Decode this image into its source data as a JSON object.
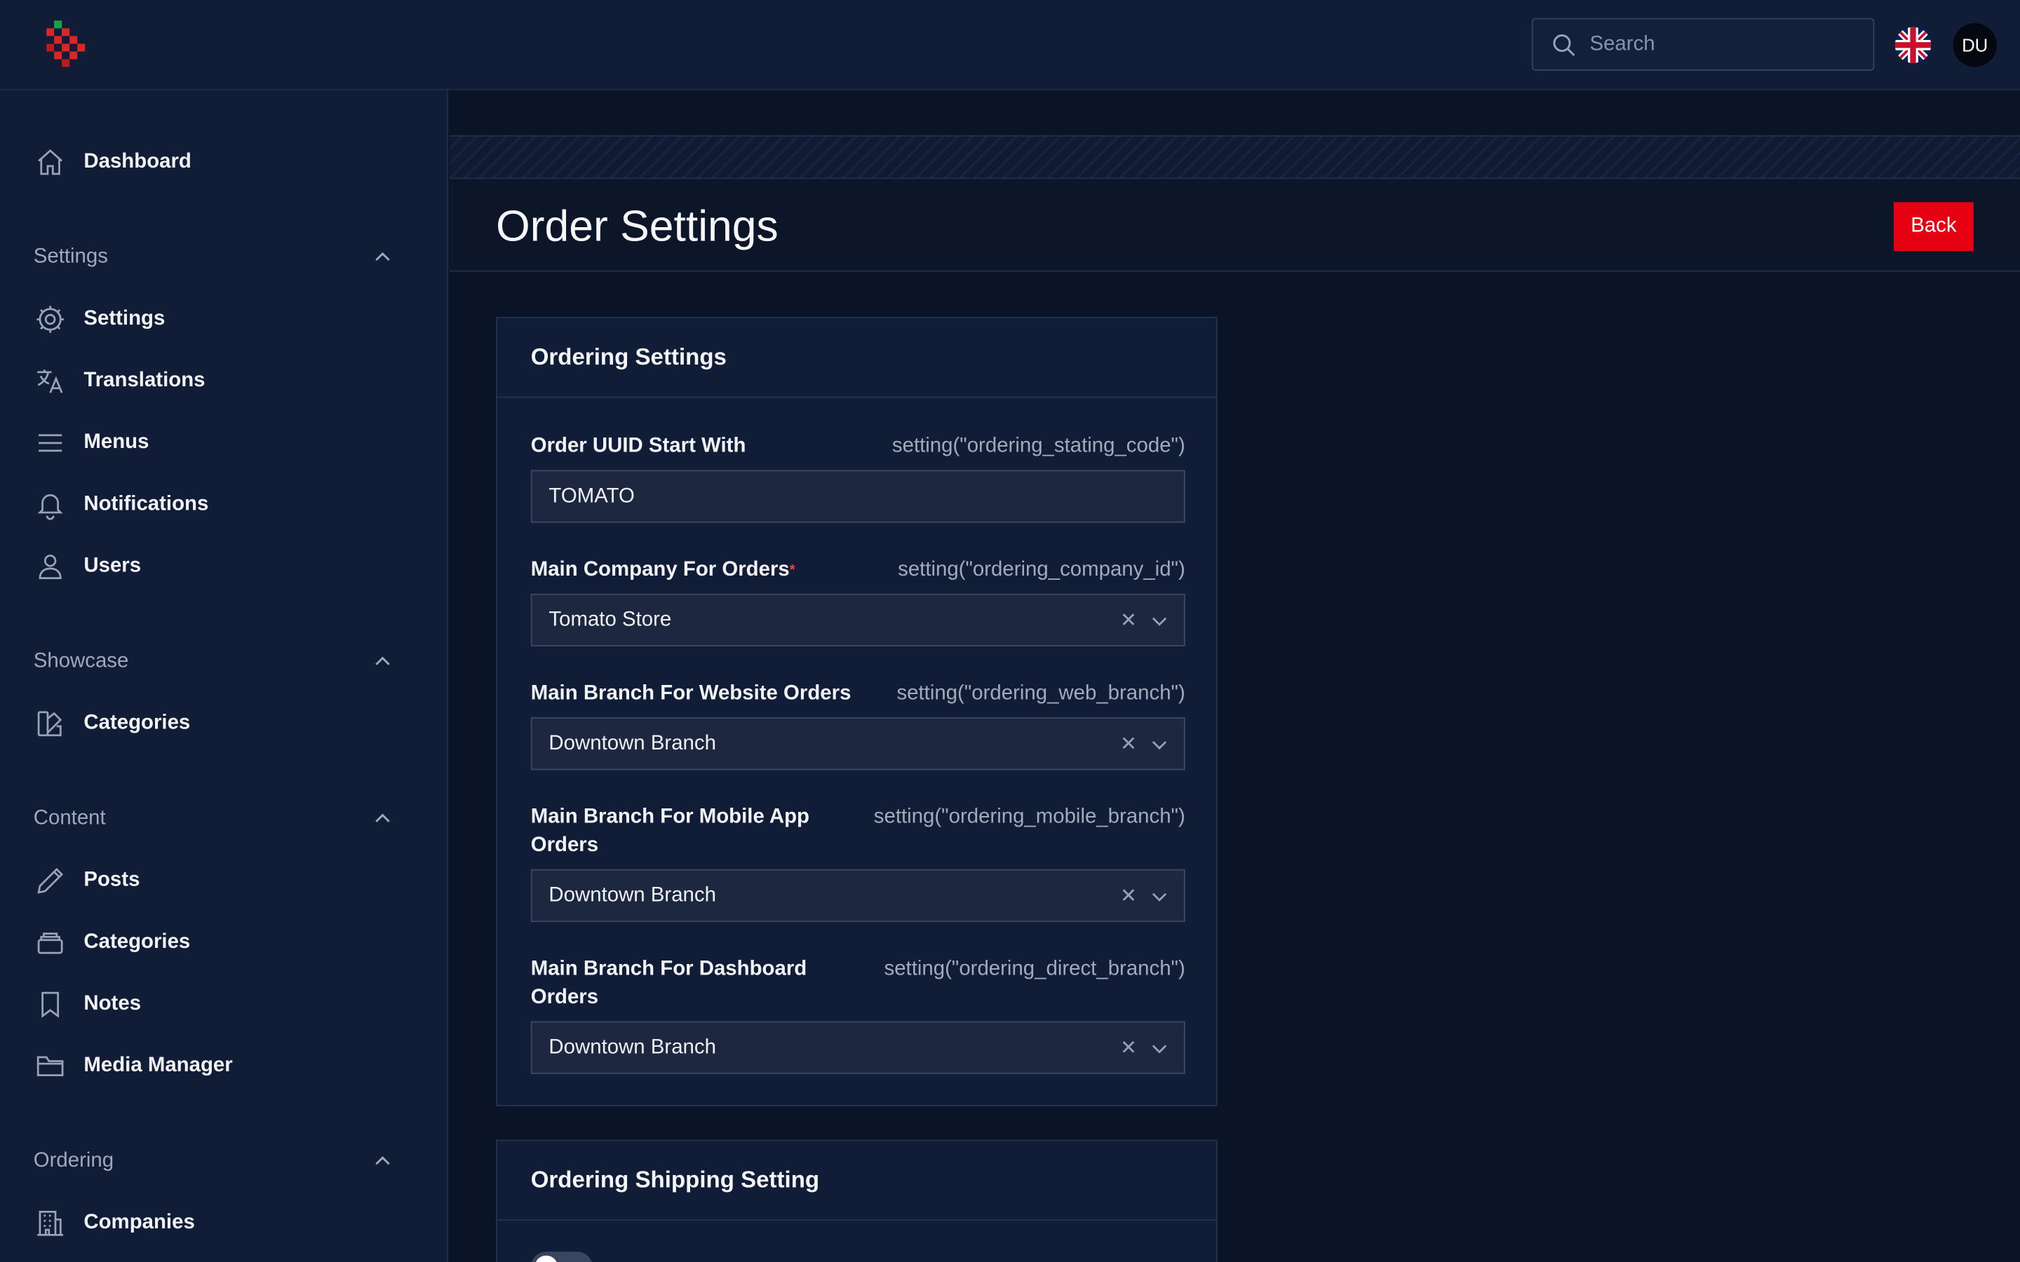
{
  "topbar": {
    "search_placeholder": "Search",
    "avatar_initials": "DU",
    "language_flag": "uk-flag-icon"
  },
  "sidebar": {
    "items": [
      {
        "label": "Dashboard",
        "icon": "home-icon"
      }
    ],
    "groups": [
      {
        "label": "Settings",
        "items": [
          {
            "label": "Settings",
            "icon": "gear-icon"
          },
          {
            "label": "Translations",
            "icon": "translate-icon"
          },
          {
            "label": "Menus",
            "icon": "menu-lines-icon"
          },
          {
            "label": "Notifications",
            "icon": "bell-icon"
          },
          {
            "label": "Users",
            "icon": "user-icon"
          }
        ]
      },
      {
        "label": "Showcase",
        "items": [
          {
            "label": "Categories",
            "icon": "swatch-icon"
          }
        ]
      },
      {
        "label": "Content",
        "items": [
          {
            "label": "Posts",
            "icon": "pencil-icon"
          },
          {
            "label": "Categories",
            "icon": "stack-icon"
          },
          {
            "label": "Notes",
            "icon": "bookmark-icon"
          },
          {
            "label": "Media Manager",
            "icon": "folder-icon"
          }
        ]
      },
      {
        "label": "Ordering",
        "items": [
          {
            "label": "Companies",
            "icon": "building-icon"
          }
        ]
      }
    ]
  },
  "page": {
    "title": "Order Settings",
    "back_label": "Back"
  },
  "ordering_settings": {
    "title": "Ordering Settings",
    "fields": [
      {
        "label": "Order UUID Start With",
        "hint": "setting(\"ordering_stating_code\")",
        "value": "TOMATO",
        "required": false
      },
      {
        "label": "Main Company For Orders",
        "hint": "setting(\"ordering_company_id\")",
        "value": "Tomato Store",
        "required": true
      },
      {
        "label": "Main Branch For Website Orders",
        "hint": "setting(\"ordering_web_branch\")",
        "value": "Downtown Branch",
        "required": false
      },
      {
        "label": "Main Branch For Mobile App Orders",
        "hint": "setting(\"ordering_mobile_branch\")",
        "value": "Downtown Branch",
        "required": false
      },
      {
        "label": "Main Branch For Dashboard Orders",
        "hint": "setting(\"ordering_direct_branch\")",
        "value": "Downtown Branch",
        "required": false
      }
    ]
  },
  "shipping_settings": {
    "title": "Ordering Shipping Setting",
    "toggle_on": false
  },
  "colors": {
    "accent_red": "#e60012",
    "background": "#0b1426",
    "panel": "#111c36"
  }
}
